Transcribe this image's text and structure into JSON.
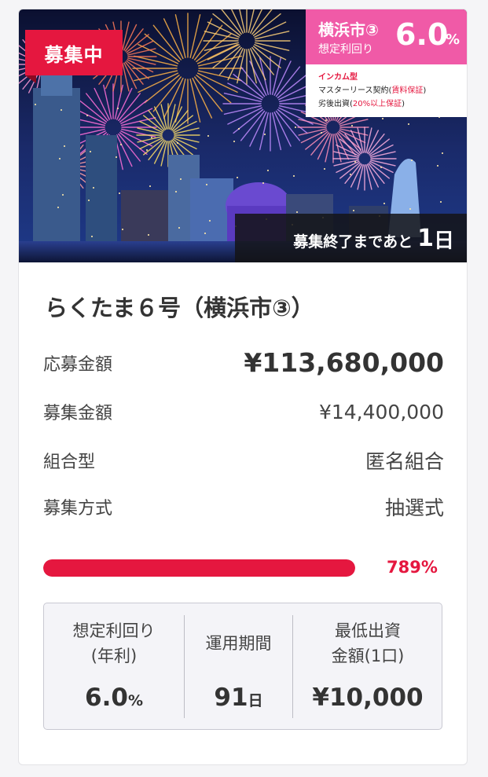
{
  "hero": {
    "status_badge": "募集中",
    "yield_city": "横浜市③",
    "yield_label": "想定利回り",
    "yield_value": "6.0",
    "yield_unit": "%",
    "income_type": "インカム型",
    "master_lease_prefix": "マスターリース契約(",
    "master_lease_em": "賃料保証",
    "master_lease_suffix": ")",
    "subordinated_prefix": "劣後出資(",
    "subordinated_em": "20%以上保証",
    "subordinated_suffix": ")",
    "countdown_text": "募集終了まであと",
    "countdown_num": "1",
    "countdown_unit": "日"
  },
  "fund": {
    "title": "らくたま６号（横浜市③）",
    "rows": [
      {
        "label": "応募金額",
        "value": "¥113,680,000"
      },
      {
        "label": "募集金額",
        "value": "¥14,400,000"
      },
      {
        "label": "組合型",
        "value": "匿名組合"
      },
      {
        "label": "募集方式",
        "value": "抽選式"
      }
    ],
    "progress_percent": 789,
    "progress_label": "789%"
  },
  "stats": {
    "yield": {
      "label1": "想定利回り",
      "label2": "(年利)",
      "value": "6.0",
      "unit": "%"
    },
    "period": {
      "label1": "運用期間",
      "value": "91",
      "unit": "日"
    },
    "minimum": {
      "label1": "最低出資",
      "label2": "金額(1口)",
      "value": "¥10,000"
    }
  },
  "colors": {
    "accent": "#e5173f",
    "pink": "#f05aa7"
  }
}
